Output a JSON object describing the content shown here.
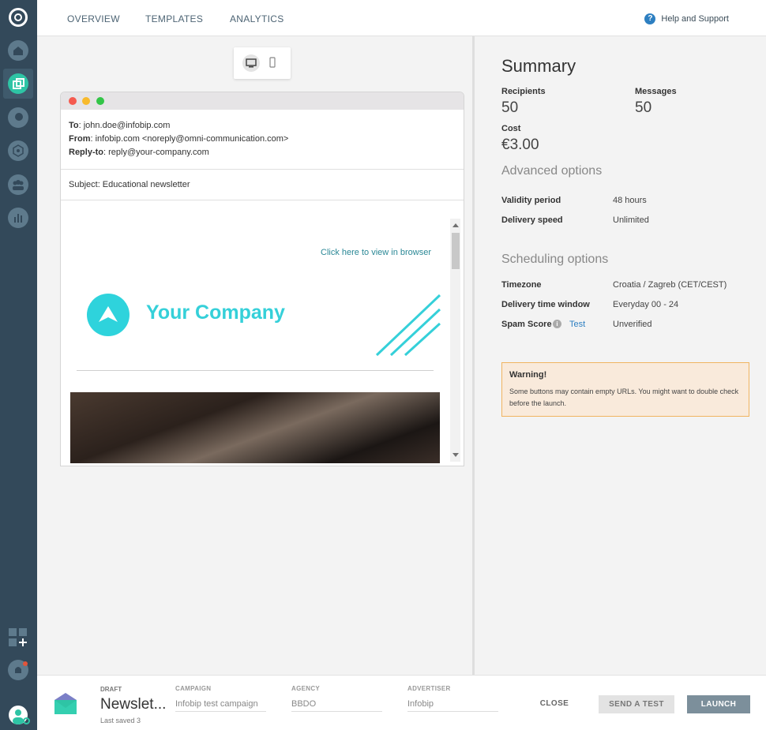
{
  "nav": {
    "tabs": [
      {
        "label": "OVERVIEW"
      },
      {
        "label": "TEMPLATES"
      },
      {
        "label": "ANALYTICS"
      }
    ],
    "help": "Help and Support"
  },
  "sidebar": {
    "icons": [
      "app-logo-icon",
      "home-icon",
      "campaigns-icon",
      "people-search-icon",
      "network-icon",
      "people-icon",
      "analytics-icon",
      "apps-add-icon",
      "notifications-icon",
      "user-avatar-icon"
    ]
  },
  "preview": {
    "to_label": "To",
    "to": ": john.doe@infobip.com",
    "from_label": "From",
    "from": ": infobip.com <noreply@omni-communication.com>",
    "replyto_label": "Reply-to",
    "replyto": ": reply@your-company.com",
    "subject": "Subject: Educational newsletter",
    "view_link": "Click here to view in browser",
    "company": "Your Company"
  },
  "summary": {
    "title": "Summary",
    "recipients_label": "Recipients",
    "recipients": "50",
    "messages_label": "Messages",
    "messages": "50",
    "cost_label": "Cost",
    "cost": "€3.00",
    "advanced_title": "Advanced options",
    "validity_label": "Validity period",
    "validity": "48 hours",
    "speed_label": "Delivery speed",
    "speed": "Unlimited",
    "scheduling_title": "Scheduling options",
    "timezone_label": "Timezone",
    "timezone": "Croatia / Zagreb (CET/CEST)",
    "window_label": "Delivery time window",
    "window": "Everyday 00 - 24",
    "spam_label": "Spam Score",
    "spam_test": "Test",
    "spam": "Unverified"
  },
  "warning": {
    "title": "Warning!",
    "message": "Some buttons may contain empty URLs. You might want to double check before the launch."
  },
  "footer": {
    "status": "DRAFT",
    "name": "Newslet...",
    "saved": "Last saved 3",
    "campaign_label": "CAMPAIGN",
    "campaign": "Infobip test campaign",
    "agency_label": "AGENCY",
    "agency": "BBDO",
    "advertiser_label": "ADVERTISER",
    "advertiser": "Infobip",
    "close": "CLOSE",
    "send_test": "SEND A TEST",
    "launch": "LAUNCH"
  },
  "colors": {
    "sidebar": "#33495a",
    "accent": "#2ed3dc",
    "launch": "#7c8f9b",
    "warning_bg": "#f9eadb"
  }
}
